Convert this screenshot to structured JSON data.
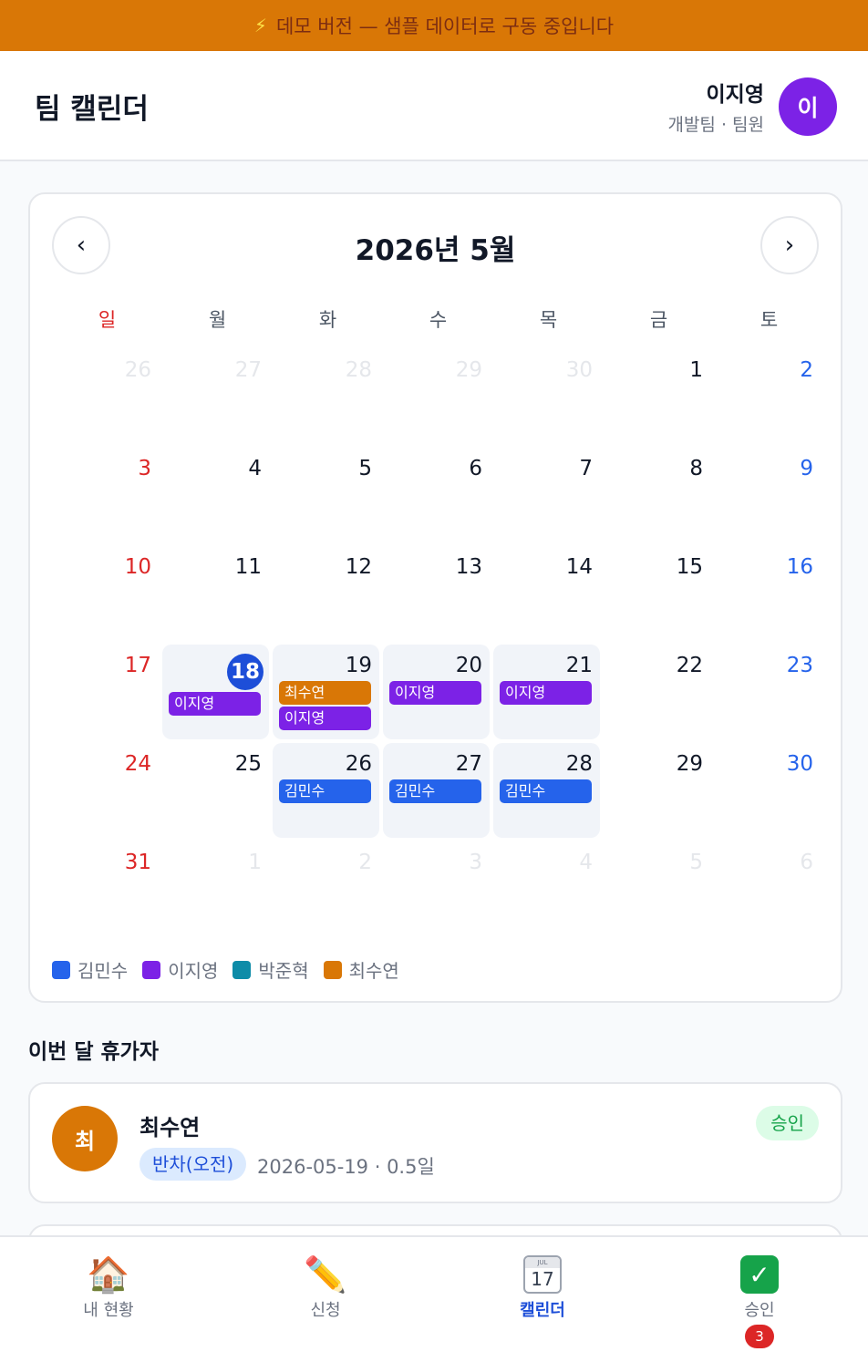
{
  "banner": {
    "icon": "⚡",
    "text": "데모 버전 — 샘플 데이터로 구동 중입니다"
  },
  "header": {
    "title": "팀 캘린더",
    "user_name": "이지영",
    "user_role": "개발팀 · 팀원",
    "avatar_initial": "이"
  },
  "calendar": {
    "month_label": "2026년 5월",
    "prev_label": "‹",
    "next_label": "›",
    "weekdays": [
      "일",
      "월",
      "화",
      "수",
      "목",
      "금",
      "토"
    ],
    "weeks": [
      [
        {
          "d": "26",
          "out": true
        },
        {
          "d": "27",
          "out": true
        },
        {
          "d": "28",
          "out": true
        },
        {
          "d": "29",
          "out": true
        },
        {
          "d": "30",
          "out": true
        },
        {
          "d": "1"
        },
        {
          "d": "2"
        }
      ],
      [
        {
          "d": "3"
        },
        {
          "d": "4"
        },
        {
          "d": "5"
        },
        {
          "d": "6"
        },
        {
          "d": "7"
        },
        {
          "d": "8"
        },
        {
          "d": "9"
        }
      ],
      [
        {
          "d": "10"
        },
        {
          "d": "11"
        },
        {
          "d": "12"
        },
        {
          "d": "13"
        },
        {
          "d": "14"
        },
        {
          "d": "15"
        },
        {
          "d": "16"
        }
      ],
      [
        {
          "d": "17"
        },
        {
          "d": "18",
          "today": true,
          "events": [
            {
              "name": "이지영",
              "color": "#7c22e6"
            }
          ]
        },
        {
          "d": "19",
          "events": [
            {
              "name": "최수연",
              "color": "#d97706"
            },
            {
              "name": "이지영",
              "color": "#7c22e6"
            }
          ]
        },
        {
          "d": "20",
          "events": [
            {
              "name": "이지영",
              "color": "#7c22e6"
            }
          ]
        },
        {
          "d": "21",
          "events": [
            {
              "name": "이지영",
              "color": "#7c22e6"
            }
          ]
        },
        {
          "d": "22"
        },
        {
          "d": "23"
        }
      ],
      [
        {
          "d": "24"
        },
        {
          "d": "25"
        },
        {
          "d": "26",
          "events": [
            {
              "name": "김민수",
              "color": "#2563eb"
            }
          ]
        },
        {
          "d": "27",
          "events": [
            {
              "name": "김민수",
              "color": "#2563eb"
            }
          ]
        },
        {
          "d": "28",
          "events": [
            {
              "name": "김민수",
              "color": "#2563eb"
            }
          ]
        },
        {
          "d": "29"
        },
        {
          "d": "30"
        }
      ],
      [
        {
          "d": "31"
        },
        {
          "d": "1",
          "out": true
        },
        {
          "d": "2",
          "out": true
        },
        {
          "d": "3",
          "out": true
        },
        {
          "d": "4",
          "out": true
        },
        {
          "d": "5",
          "out": true
        },
        {
          "d": "6",
          "out": true
        }
      ]
    ],
    "legend": [
      {
        "name": "김민수",
        "color": "#2563eb"
      },
      {
        "name": "이지영",
        "color": "#7c22e6"
      },
      {
        "name": "박준혁",
        "color": "#0e8ca8"
      },
      {
        "name": "최수연",
        "color": "#d97706"
      }
    ]
  },
  "leave_section": {
    "title": "이번 달 휴가자",
    "items": [
      {
        "initial": "최",
        "name": "최수연",
        "type": "반차(오전)",
        "date": "2026-05-19 · 0.5일",
        "status": "승인",
        "avatar_color": "#d97706"
      }
    ]
  },
  "tabs": [
    {
      "icon": "🏠",
      "icon_name": "home-icon",
      "label": "내 현황"
    },
    {
      "icon": "✏️",
      "icon_name": "pencil-icon",
      "label": "신청"
    },
    {
      "icon": "17",
      "icon_name": "calendar-icon",
      "label": "캘린더",
      "active": true,
      "icon_top": "JUL"
    },
    {
      "icon": "✓",
      "icon_name": "check-icon",
      "label": "승인",
      "badge": "3"
    }
  ]
}
